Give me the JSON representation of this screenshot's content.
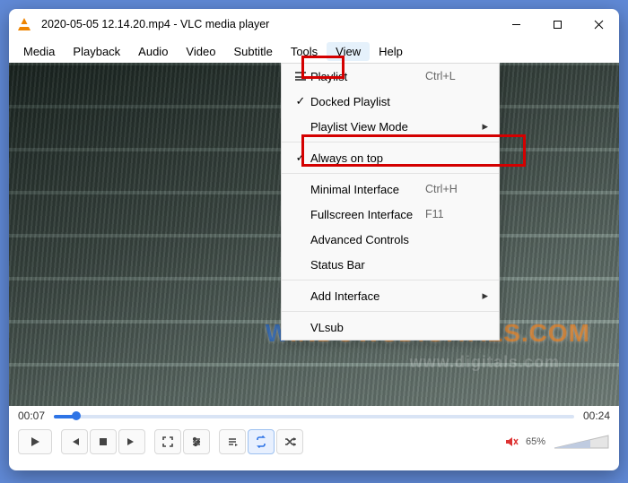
{
  "titlebar": {
    "title": "2020-05-05 12.14.20.mp4 - VLC media player"
  },
  "menubar": {
    "items": [
      {
        "label": "Media"
      },
      {
        "label": "Playback"
      },
      {
        "label": "Audio"
      },
      {
        "label": "Video"
      },
      {
        "label": "Subtitle"
      },
      {
        "label": "Tools"
      },
      {
        "label": "View",
        "active": true
      },
      {
        "label": "Help"
      }
    ]
  },
  "view_menu": {
    "items": [
      {
        "icon": "list",
        "label": "Playlist",
        "accel": "Ctrl+L"
      },
      {
        "icon": "check",
        "label": "Docked Playlist"
      },
      {
        "label": "Playlist View Mode",
        "submenu": true
      },
      {
        "sep": true
      },
      {
        "icon": "check",
        "label": "Always on top",
        "highlighted": true
      },
      {
        "sep": true
      },
      {
        "label": "Minimal Interface",
        "accel": "Ctrl+H"
      },
      {
        "label": "Fullscreen Interface",
        "accel": "F11"
      },
      {
        "label": "Advanced Controls"
      },
      {
        "label": "Status Bar"
      },
      {
        "sep": true
      },
      {
        "label": "Add Interface",
        "submenu": true
      },
      {
        "sep": true
      },
      {
        "label": "VLsub"
      }
    ]
  },
  "playback": {
    "elapsed": "00:07",
    "total": "00:24",
    "volume_pct": "65%"
  },
  "watermark": {
    "w": "W",
    "rest": "INDOWSDIGITALS.COM",
    "shadow": "www.digitals.com"
  }
}
